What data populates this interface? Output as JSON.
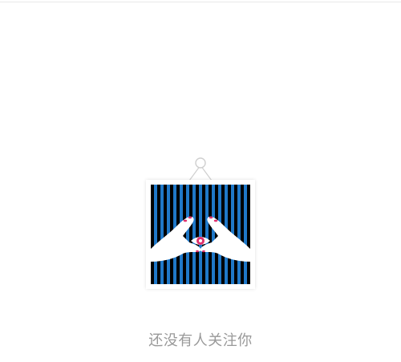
{
  "empty_state": {
    "message": "还没有人关注你",
    "illustration_icon": "hanging-picture-hands-eye-icon"
  },
  "colors": {
    "message_text": "#999999",
    "stripe_blue": "#1f78c8",
    "stripe_black": "#000000",
    "accent_pink": "#e0316e"
  }
}
